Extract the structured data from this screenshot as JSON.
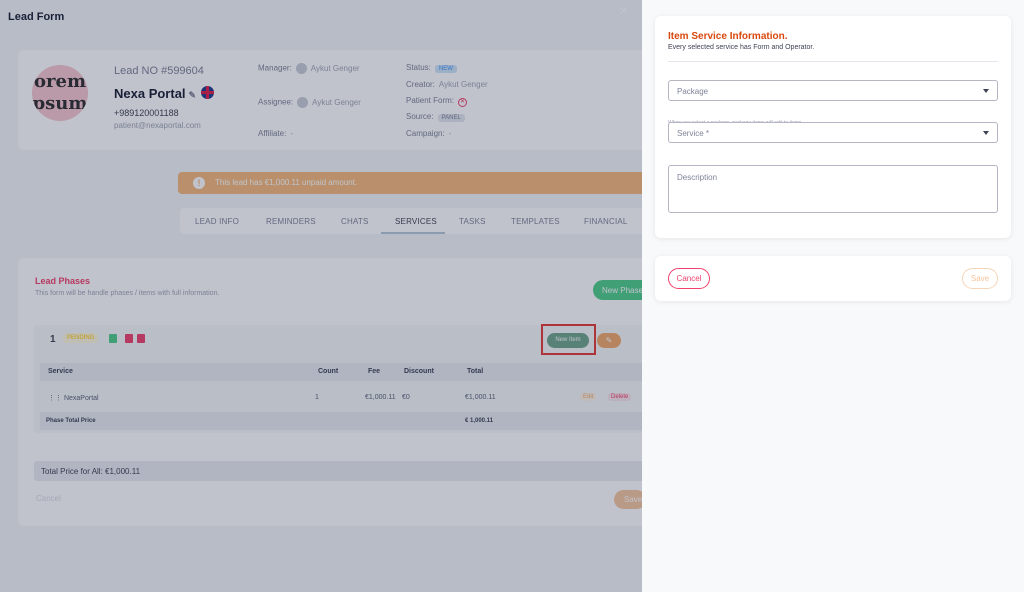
{
  "window": {
    "title": "Lead Form",
    "close_icon": "×"
  },
  "lead": {
    "avatar_text": "orem psum",
    "number": "Lead NO #599604",
    "name": "Nexa Portal",
    "phone": "+989120001188",
    "email": "patient@nexaportal.com",
    "manager_label": "Manager:",
    "manager": "Aykut Genger",
    "assignee_label": "Assignee:",
    "assignee": "Aykut Genger",
    "affiliate_label": "Affiliate:",
    "affiliate": "-",
    "status_label": "Status:",
    "status": "NEW",
    "creator_label": "Creator:",
    "creator": "Aykut Genger",
    "patient_form_label": "Patient Form:",
    "source_label": "Source:",
    "source": "PANEL",
    "campaign_label": "Campaign:",
    "campaign": "-"
  },
  "alert": {
    "text": "This lead has €1,000.11 unpaid amount."
  },
  "tabs": [
    "LEAD INFO",
    "REMINDERS",
    "CHATS",
    "SERVICES",
    "TASKS",
    "TEMPLATES",
    "FINANCIAL"
  ],
  "active_tab": "SERVICES",
  "phases": {
    "title": "Lead Phases",
    "subtitle": "This form will be handle phases / items with full information.",
    "new_phase_label": "New Phase",
    "phase_number": "1",
    "phase_status": "PENDING",
    "new_item_label": "New Item",
    "columns": [
      "Service",
      "Count",
      "Fee",
      "Discount",
      "Total"
    ],
    "rows": [
      {
        "service": "NexaPortal",
        "count": "1",
        "fee": "€1,000.11",
        "discount": "€0",
        "total": "€1,000.11",
        "edit": "Edit",
        "delete": "Delete"
      }
    ],
    "footer_label": "Phase Total Price",
    "footer_total": "€ 1,000.11",
    "total_all": "Total Price for All:  €1,000.11",
    "cancel_label": "Cancel",
    "save_label": "Save"
  },
  "drawer": {
    "title": "Item Service Information.",
    "subtitle": "Every selected service has Form and Operator.",
    "package_label": "Package",
    "package_hint": "When you select a package, package items will add to items.",
    "service_label": "Service *",
    "description_placeholder": "Description",
    "cancel_label": "Cancel",
    "save_label": "Save"
  },
  "colors": {
    "accent": "#d9480f",
    "danger": "#f1416c",
    "success": "#50cd89",
    "warning": "#f6b97a",
    "highlight": "#e53935"
  },
  "icons": [
    "close-icon",
    "edit-icon",
    "uk-flag-icon",
    "person-icon",
    "x-circle-icon",
    "info-icon",
    "chevron-down-icon",
    "pencil-icon",
    "drag-handle-icon"
  ]
}
